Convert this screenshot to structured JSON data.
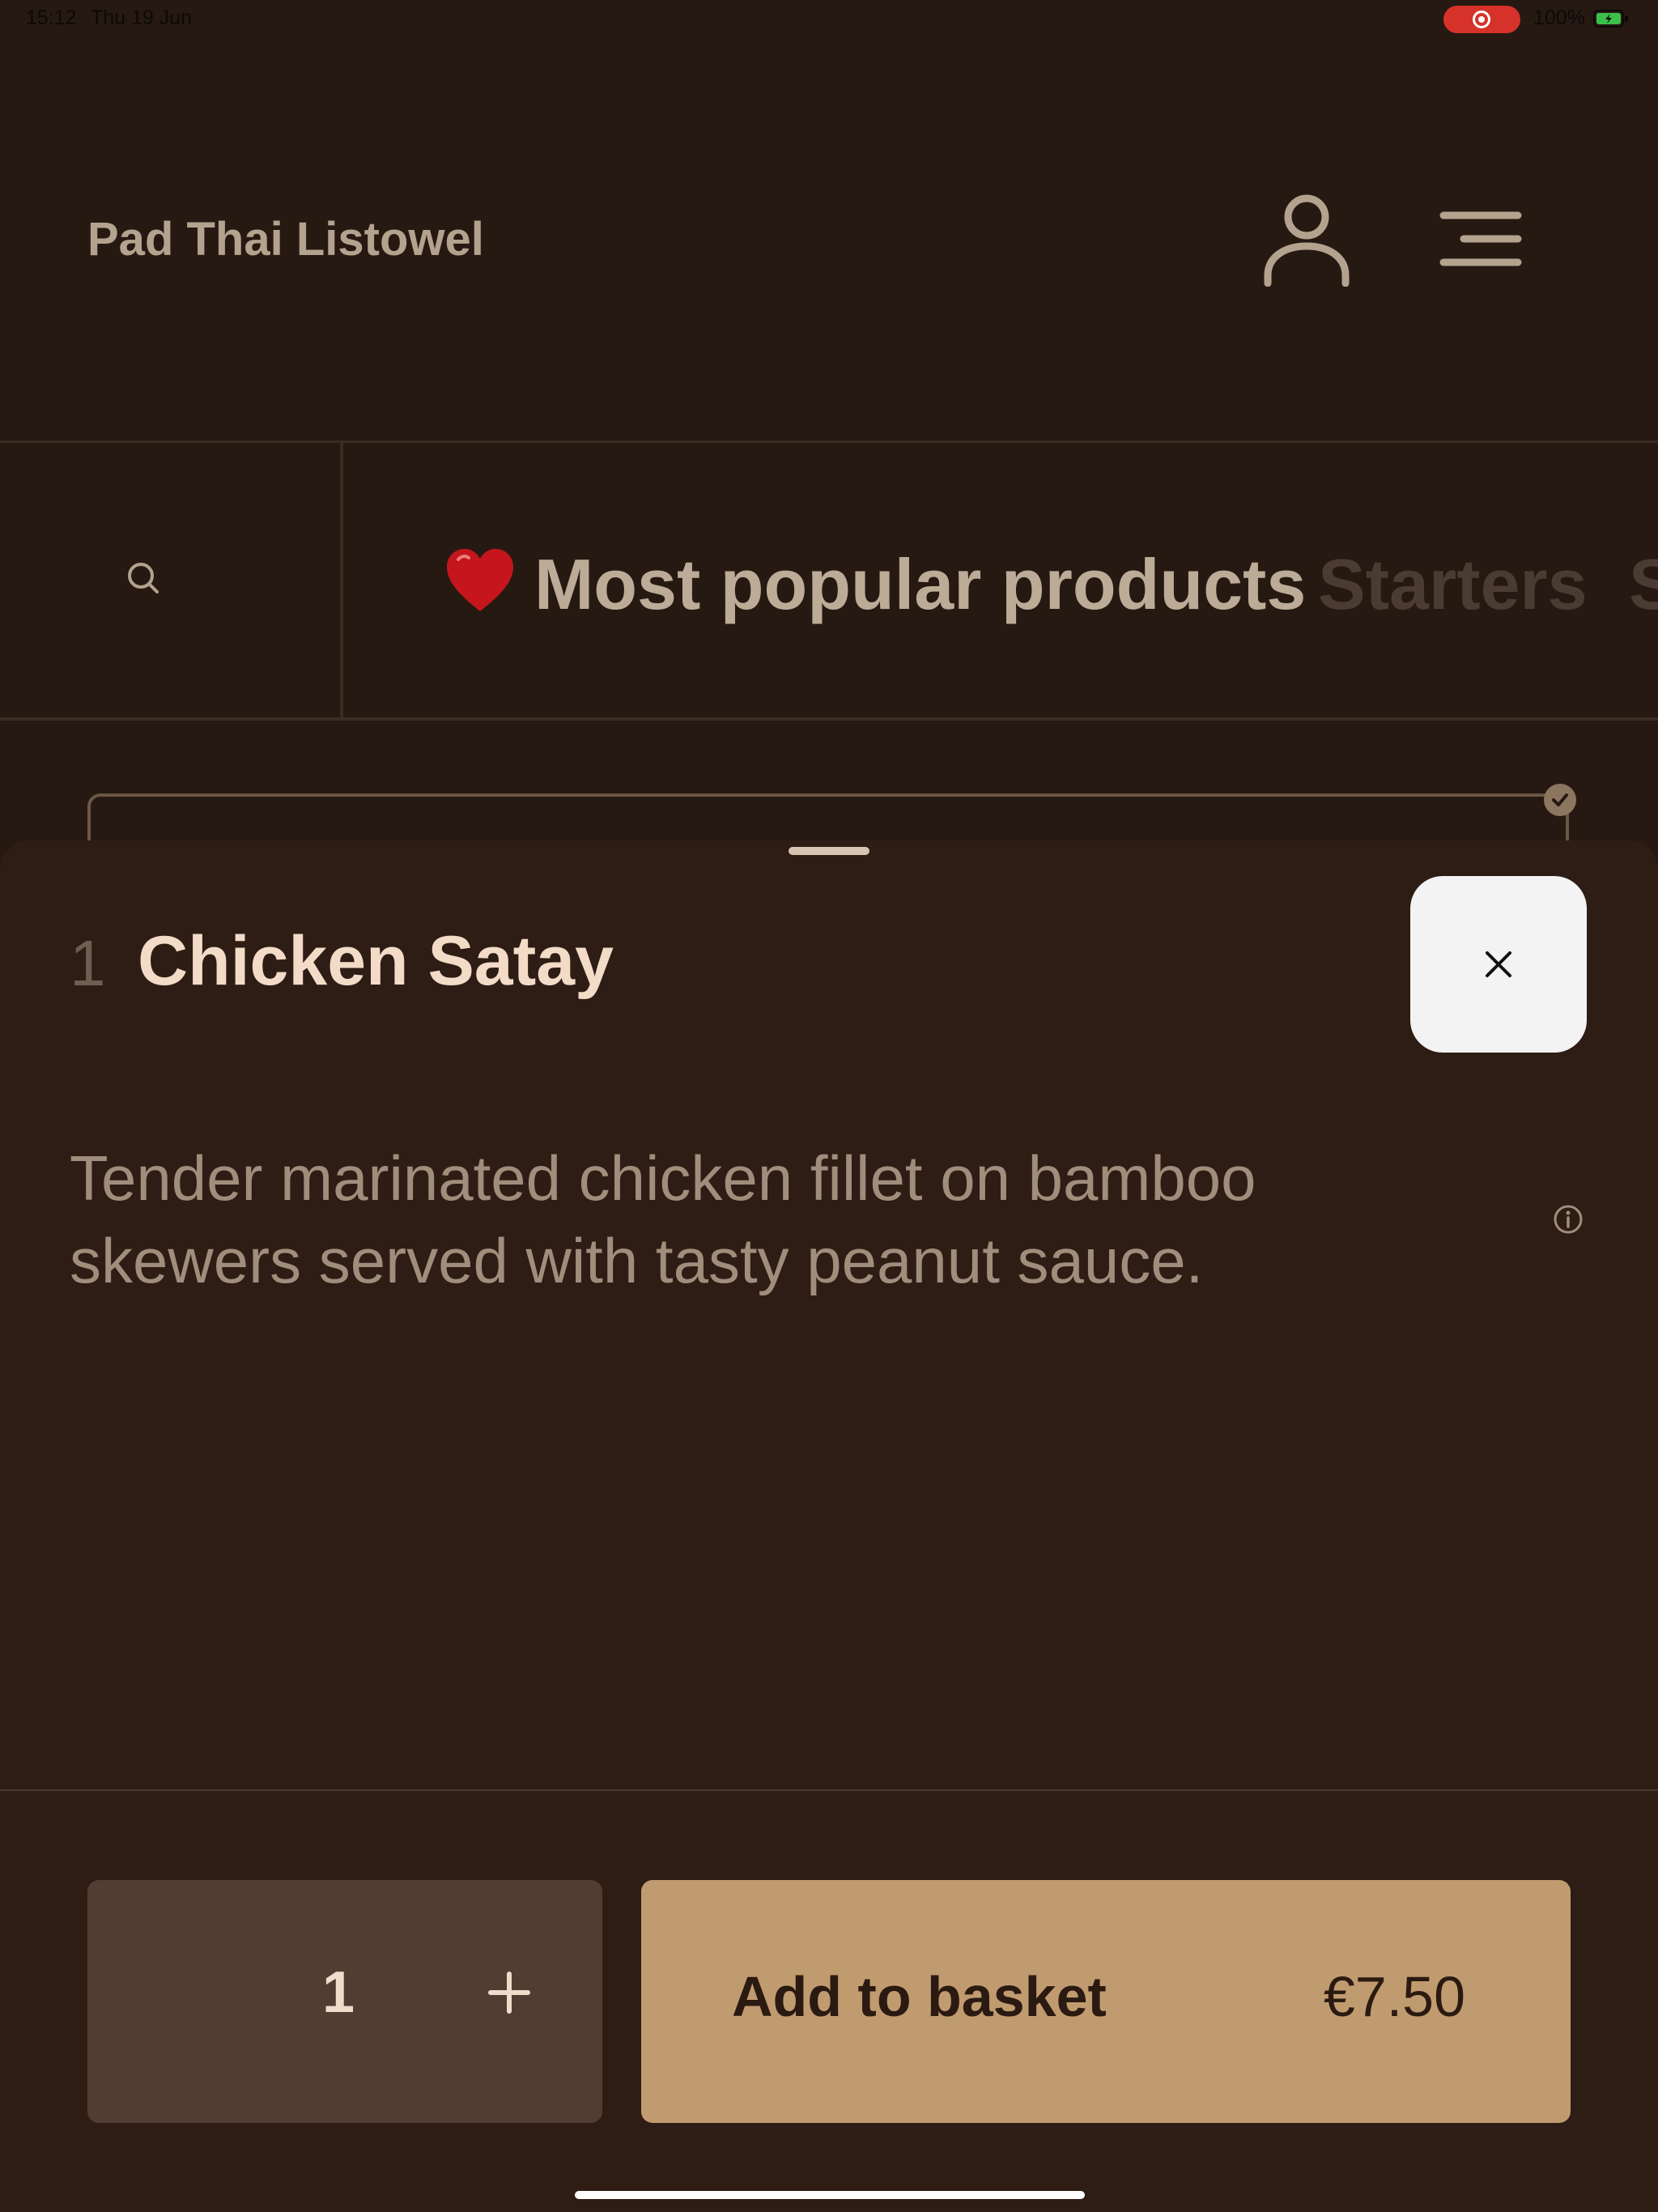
{
  "status_bar": {
    "time": "15:12",
    "date": "Thu 19 Jun",
    "battery": "100%",
    "recording_color": "#d6322a"
  },
  "header": {
    "brand": "Pad Thai Listowel",
    "icons": [
      "user-icon",
      "menu-icon"
    ]
  },
  "categories": {
    "search_icon": "search-icon",
    "active_emoji": "heart-icon",
    "items": [
      "Most popular products",
      "Starters",
      "S"
    ]
  },
  "product": {
    "number": "1",
    "name": "Chicken Satay",
    "description": "Tender marinated chicken fillet on bamboo skewers served with tasty peanut sauce."
  },
  "actions": {
    "quantity": "1",
    "plus": "+",
    "add_label": "Add to basket",
    "price": "€7.50"
  },
  "colors": {
    "background": "#261912",
    "sheet": "#2e1d15",
    "accent": "#c19b70",
    "stepper": "#513d31"
  }
}
